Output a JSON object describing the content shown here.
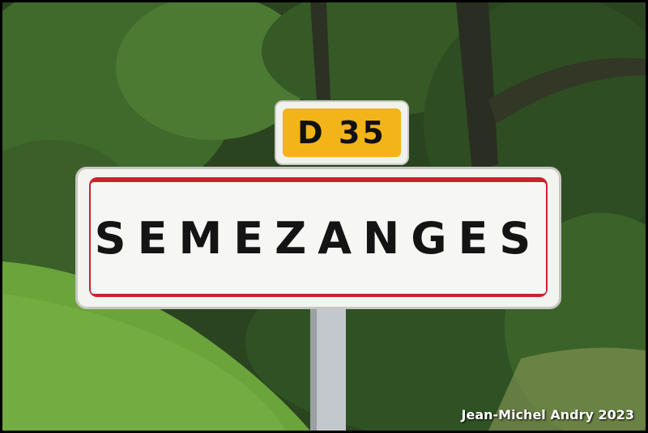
{
  "sign": {
    "route_number": "D 35",
    "town_name": "SEMEZANGES"
  },
  "credit": "Jean-Michel Andry 2023",
  "colors": {
    "route_plate": "#f2b419",
    "sign_border": "#c8232c",
    "sign_face": "#f6f6f4",
    "foliage": "#2f4a22",
    "grass": "#6aa43a"
  }
}
